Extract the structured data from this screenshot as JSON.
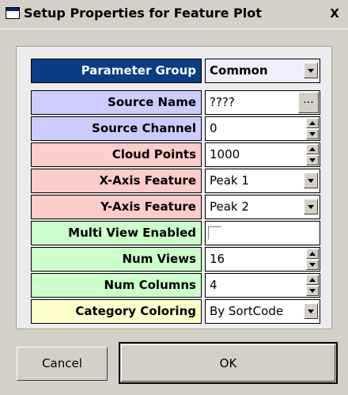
{
  "window": {
    "title": "Setup Properties for Feature Plot",
    "close_label": "X"
  },
  "parameter_group": {
    "label": "Parameter Group",
    "value": "Common"
  },
  "rows": [
    {
      "label": "Source Name",
      "value": "????"
    },
    {
      "label": "Source Channel",
      "value": "0"
    },
    {
      "label": "Cloud Points",
      "value": "1000"
    },
    {
      "label": "X-Axis Feature",
      "value": "Peak 1"
    },
    {
      "label": "Y-Axis Feature",
      "value": "Peak 2"
    },
    {
      "label": "Multi View Enabled",
      "value": ""
    },
    {
      "label": "Num Views",
      "value": "16"
    },
    {
      "label": "Num Columns",
      "value": "4"
    },
    {
      "label": "Category Coloring",
      "value": "By SortCode"
    }
  ],
  "browse_label": "...",
  "buttons": {
    "cancel": "Cancel",
    "ok": "OK"
  },
  "colors": {
    "source": "#ccccff",
    "plot": "#ffcccc",
    "views": "#ccffcc",
    "coloring": "#ffffcc",
    "group_header": "#0b3c86"
  }
}
